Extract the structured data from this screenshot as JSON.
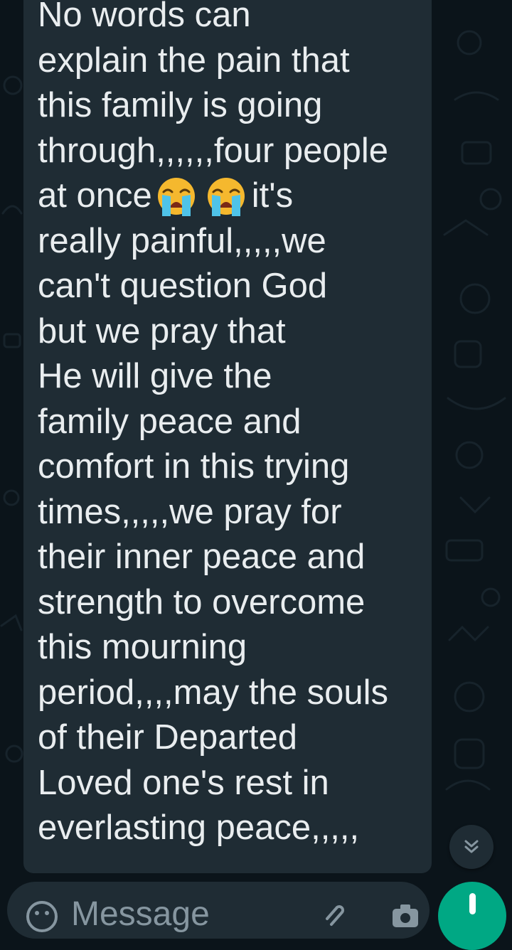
{
  "conversation": {
    "message": {
      "lines": [
        "No words can",
        "explain the pain that",
        "this family is going",
        "through,,,,,,four people"
      ],
      "emoji_line_before": "at once",
      "emoji_line_after": "it's",
      "emoji": "loudly-crying-face",
      "emoji_count": 2,
      "rest": "really painful,,,,,we\ncan't question God\nbut we pray that\nHe will give the\nfamily peace and\ncomfort in this trying\ntimes,,,,,we pray for\ntheir inner peace and\nstrength to overcome\nthis mourning\nperiod,,,,may the souls\nof their Departed\nLoved one's rest in\neverlasting peace,,,,,"
    }
  },
  "composer": {
    "placeholder": "Message",
    "emoji_icon": "emoji-smiley-icon",
    "attach_icon": "paperclip-icon",
    "camera_icon": "camera-icon",
    "mic_icon": "microphone-icon"
  },
  "scroll_button": {
    "icon": "double-chevron-down-icon"
  },
  "colors": {
    "background": "#0b141a",
    "bubble": "#1f2c34",
    "text": "#e9edef",
    "placeholder": "#8696a0",
    "accent": "#00a884"
  }
}
